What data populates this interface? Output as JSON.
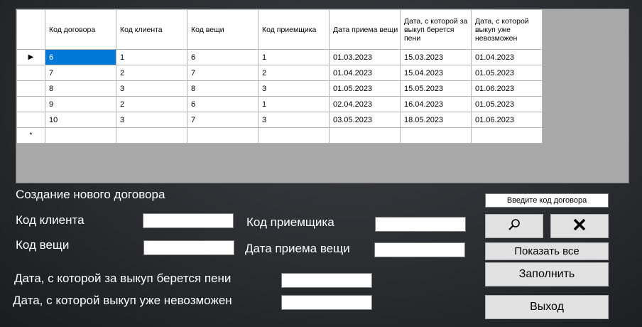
{
  "grid": {
    "columns": [
      "Код договора",
      "Код клиента",
      "Код вещи",
      "Код приемщика",
      "Дата приема вещи",
      "Дата, с которой за выкуп берется пени",
      "Дата, с которой выкуп уже невозможен"
    ],
    "rows": [
      [
        "6",
        "1",
        "6",
        "1",
        "01.03.2023",
        "15.03.2023",
        "01.04.2023"
      ],
      [
        "7",
        "2",
        "7",
        "2",
        "01.04.2023",
        "15.04.2023",
        "01.05.2023"
      ],
      [
        "8",
        "3",
        "8",
        "3",
        "01.05.2023",
        "15.05.2023",
        "01.06.2023"
      ],
      [
        "9",
        "2",
        "6",
        "1",
        "02.04.2023",
        "16.04.2023",
        "01.05.2023"
      ],
      [
        "10",
        "3",
        "7",
        "3",
        "03.05.2023",
        "18.05.2023",
        "01.06.2023"
      ]
    ],
    "current_row_marker": "▶",
    "new_row_marker": "*"
  },
  "form": {
    "title": "Создание нового договора",
    "client_code_label": "Код клиента",
    "item_code_label": "Код вещи",
    "receiver_code_label": "Код приемщика",
    "receipt_date_label": "Дата приема вещи",
    "penalty_date_label": "Дата, с которой за выкуп берется пени",
    "no_buyout_date_label": "Дата, с которой выкуп уже невозможен",
    "client_code_value": "",
    "item_code_value": "",
    "receiver_code_value": "",
    "receipt_date_value": "",
    "penalty_date_value": "",
    "no_buyout_date_value": ""
  },
  "actions": {
    "contract_code_prompt": "Введите код договора",
    "search_icon": "magnifier-icon",
    "clear_icon": "x-icon",
    "show_all_label": "Показать все",
    "fill_label": "Заполнить",
    "exit_label": "Выход"
  }
}
